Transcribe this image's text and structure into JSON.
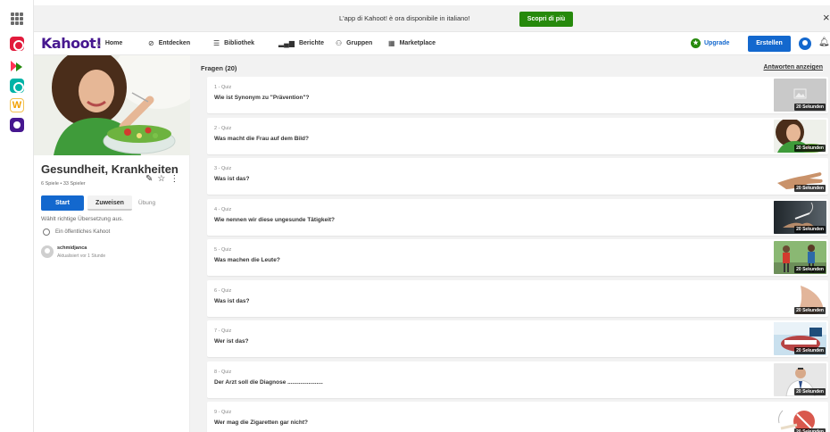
{
  "banner": {
    "message": "L'app di Kahoot! è ora disponibile in italiano!",
    "cta_label": "Scopri di più",
    "close_glyph": "×"
  },
  "nav": {
    "logo": "Kahoot!",
    "items": [
      {
        "label": "Home",
        "icon": "home-icon"
      },
      {
        "label": "Entdecken",
        "icon": "compass-icon"
      },
      {
        "label": "Bibliothek",
        "icon": "list-icon"
      },
      {
        "label": "Berichte",
        "icon": "bar-chart-icon"
      },
      {
        "label": "Gruppen",
        "icon": "groups-icon"
      },
      {
        "label": "Marketplace",
        "icon": "store-icon"
      }
    ],
    "upgrade_label": "Upgrade",
    "create_label": "Erstellen"
  },
  "kahoot": {
    "title": "Gesundheit, Krankheiten",
    "meta": "6 Spiele • 33 Spieler",
    "start_label": "Start",
    "assign_label": "Zuweisen",
    "practice_label": "Übung",
    "description": "Wählt richtige Übersetzung aus.",
    "visibility": "Ein öffentliches Kahoot",
    "author_name": "schmidjanca",
    "updated": "Aktualisiert vor 1 Stunde"
  },
  "questions": {
    "header": "Fragen (20)",
    "show_answers": "Antworten anzeigen",
    "items": [
      {
        "type": "1 - Quiz",
        "text": "Wie ist Synonym zu \"Prävention\"?",
        "duration": "20 Sekunden",
        "thumb": "placeholder"
      },
      {
        "type": "2 - Quiz",
        "text": "Was macht die Frau auf dem Bild?",
        "duration": "20 Sekunden",
        "thumb": "salad"
      },
      {
        "type": "3 - Quiz",
        "text": "Was ist das?",
        "duration": "20 Sekunden",
        "thumb": "hand"
      },
      {
        "type": "4 - Quiz",
        "text": "Wie nennen wir diese ungesunde Tätigkeit?",
        "duration": "20 Sekunden",
        "thumb": "smoking"
      },
      {
        "type": "5 - Quiz",
        "text": "Was machen die Leute?",
        "duration": "20 Sekunden",
        "thumb": "jogging"
      },
      {
        "type": "6 - Quiz",
        "text": "Was ist das?",
        "duration": "20 Sekunden",
        "thumb": "nose"
      },
      {
        "type": "7 - Quiz",
        "text": "Wer ist das?",
        "duration": "20 Sekunden",
        "thumb": "dentist"
      },
      {
        "type": "8 - Quiz",
        "text": "Der Arzt soll die Diagnose ......................",
        "duration": "20 Sekunden",
        "thumb": "doctor"
      },
      {
        "type": "9 - Quiz",
        "text": "Wer mag die Zigaretten gar nicht?",
        "duration": "20 Sekunden",
        "thumb": "cigarette"
      }
    ]
  }
}
